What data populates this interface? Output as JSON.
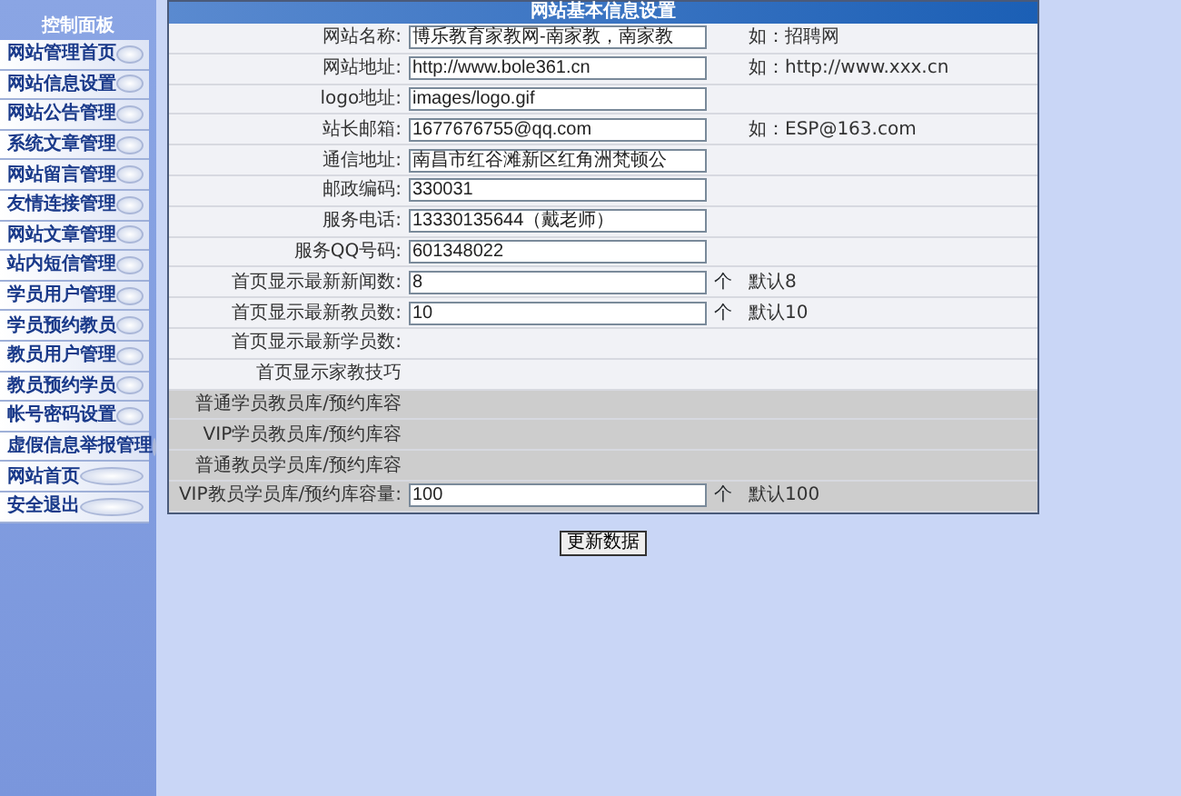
{
  "sidebar": {
    "title": "控制面板",
    "items": [
      {
        "label": "网站管理首页"
      },
      {
        "label": "网站信息设置"
      },
      {
        "label": "网站公告管理"
      },
      {
        "label": "系统文章管理"
      },
      {
        "label": "网站留言管理"
      },
      {
        "label": "友情连接管理"
      },
      {
        "label": "网站文章管理"
      },
      {
        "label": "站内短信管理"
      },
      {
        "label": "学员用户管理"
      },
      {
        "label": "学员预约教员"
      },
      {
        "label": "教员用户管理"
      },
      {
        "label": "教员预约学员"
      },
      {
        "label": "帐号密码设置"
      },
      {
        "label": "虚假信息举报管理"
      },
      {
        "label": "网站首页"
      },
      {
        "label": "安全退出"
      }
    ]
  },
  "panel": {
    "title": "网站基本信息设置",
    "rows": [
      {
        "label": "网站名称:",
        "value": "博乐教育家教网-南家教，南家教",
        "hint": "如：招聘网",
        "shaded": false
      },
      {
        "label": "网站地址:",
        "value": "http://www.bole361.cn",
        "hint": "如：http://www.xxx.cn",
        "shaded": false
      },
      {
        "label": "logo地址:",
        "value": "images/logo.gif",
        "shaded": false
      },
      {
        "label": "站长邮箱:",
        "value": "1677676755@qq.com",
        "hint": "如：ESP@163.com",
        "shaded": false
      },
      {
        "label": "通信地址:",
        "value": "南昌市红谷滩新区红角洲梵顿公",
        "shaded": false
      },
      {
        "label": "邮政编码:",
        "value": "330031",
        "shaded": false
      },
      {
        "label": "服务电话:",
        "value": "13330135644（戴老师）",
        "shaded": false
      },
      {
        "label": "服务QQ号码:",
        "value": "601348022",
        "shaded": false
      },
      {
        "label": "首页显示最新新闻数:",
        "value": "8",
        "unit": "个",
        "hint": "默认8",
        "shaded": false
      },
      {
        "label": "首页显示最新教员数:",
        "value": "10",
        "unit": "个",
        "hint": "默认10",
        "shaded": false
      },
      {
        "label": "首页显示最新学员数:",
        "shaded": false
      },
      {
        "label": "首页显示家教技巧",
        "shaded": false
      },
      {
        "label": "普通学员教员库/预约库容",
        "shaded": true
      },
      {
        "label": "VIP学员教员库/预约库容",
        "shaded": true
      },
      {
        "label": "普通教员学员库/预约库容",
        "shaded": true
      },
      {
        "label": "VIP教员学员库/预约库容量:",
        "value": "100",
        "unit": "个",
        "hint": "默认100",
        "shaded": true
      }
    ]
  },
  "submit_button": "更新数据"
}
